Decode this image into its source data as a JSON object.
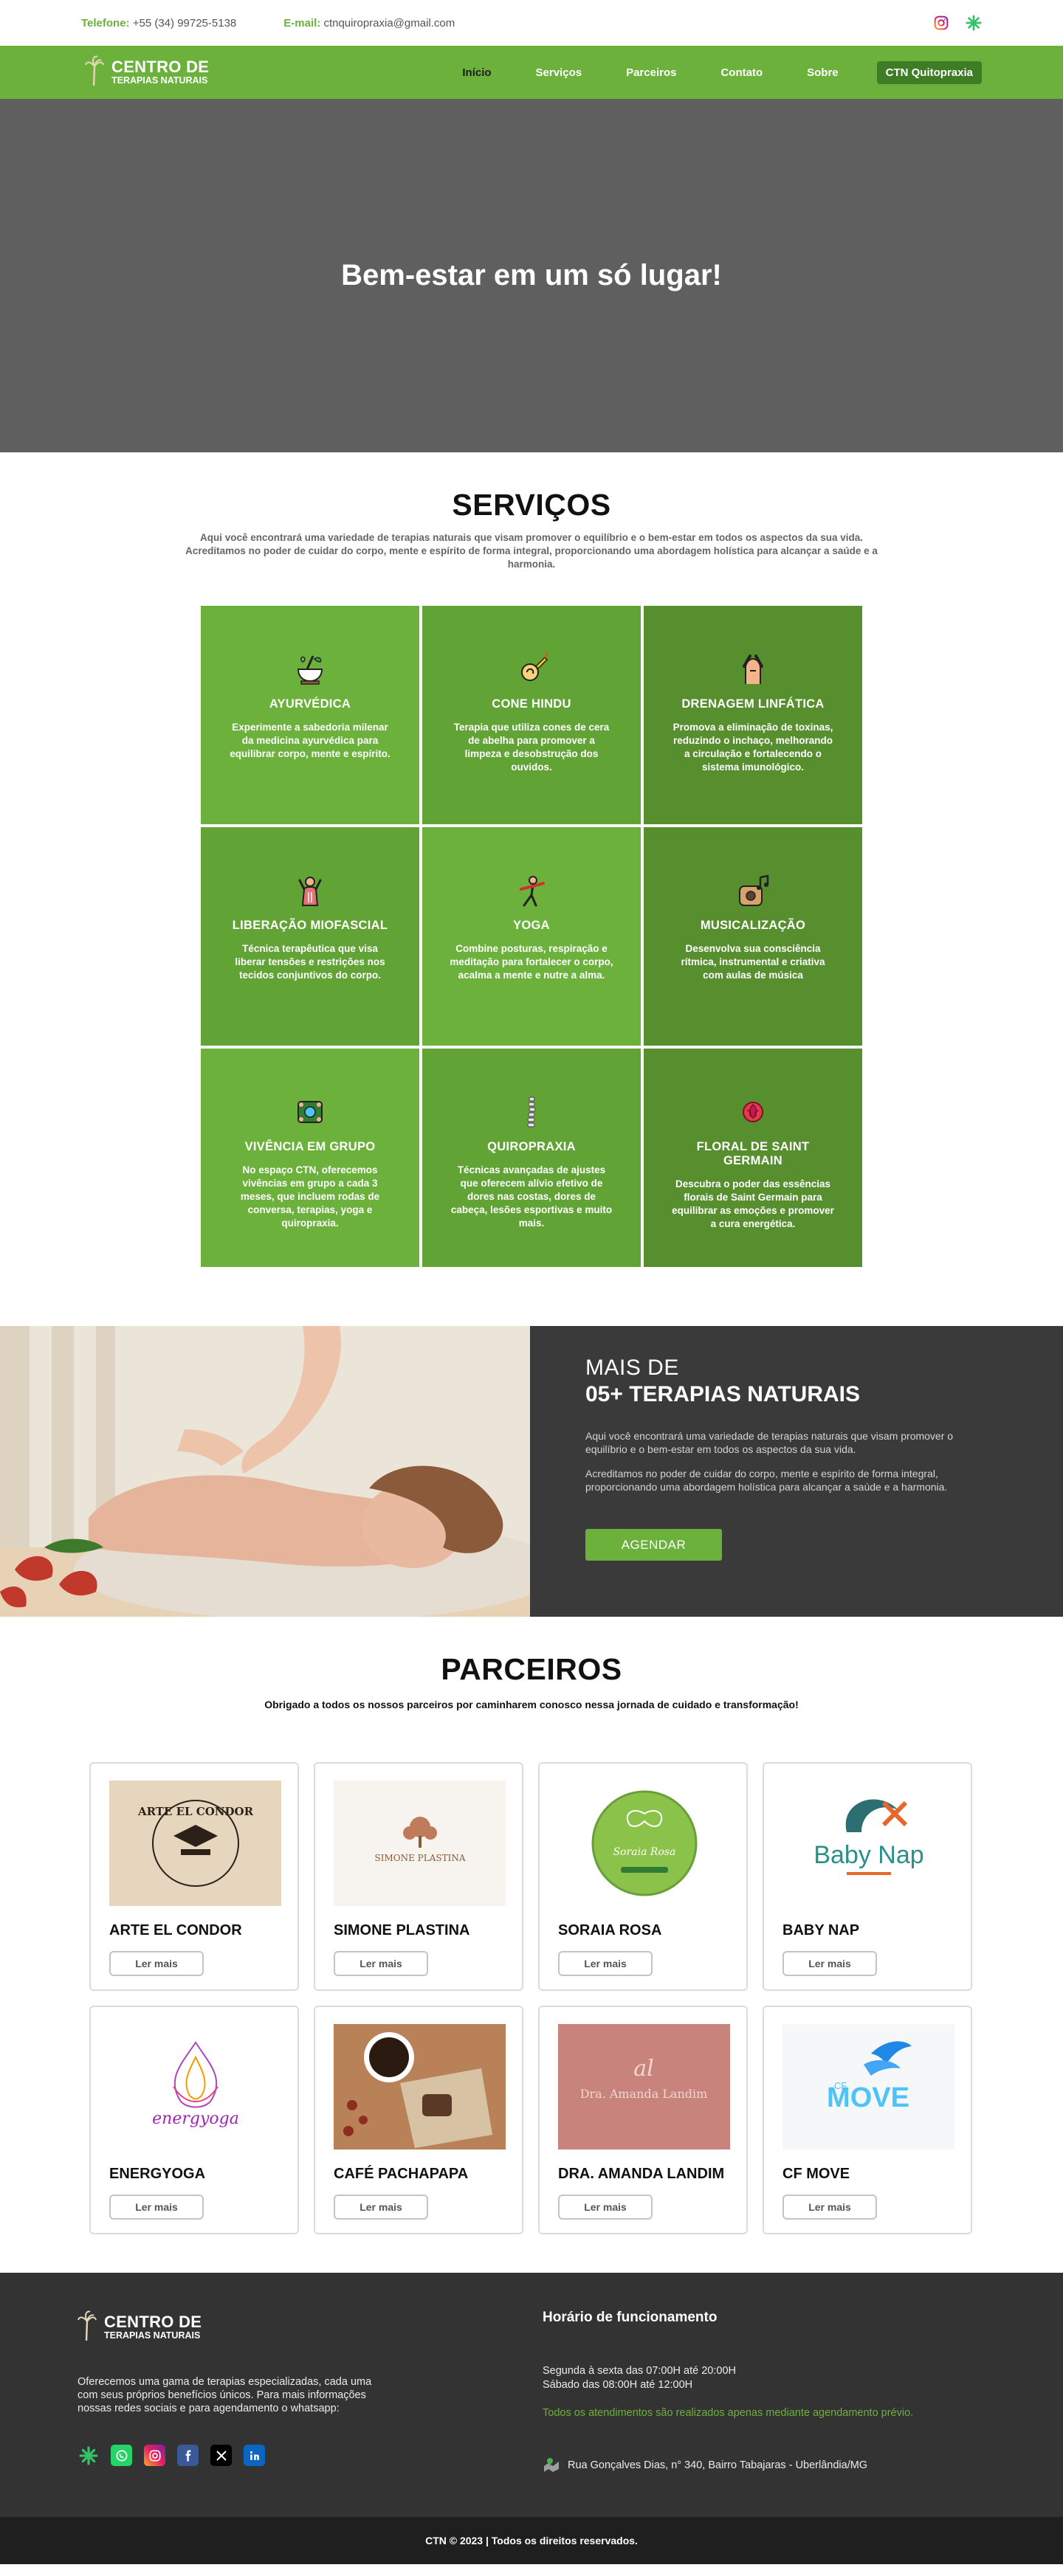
{
  "topbar": {
    "phone_label": "Telefone:",
    "phone": "+55 (34) 99725-5138",
    "email_label": "E-mail:",
    "email": "ctnquiropraxia@gmail.com",
    "socials": [
      "instagram-icon",
      "asterisk-flower-icon"
    ]
  },
  "brand": {
    "line1": "CENTRO DE",
    "line2": "TERAPIAS NATURAIS"
  },
  "nav": {
    "items": [
      "Início",
      "Serviços",
      "Parceiros",
      "Contato",
      "Sobre"
    ],
    "active": "Início",
    "cta": "CTN Quitopraxia"
  },
  "hero": {
    "title": "Bem-estar em um só lugar!"
  },
  "services": {
    "title": "SERVIÇOS",
    "intro": "Aqui você encontrará uma variedade de terapias naturais que visam promover o equilíbrio e o bem-estar em todos os aspectos da sua vida. Acreditamos no poder de cuidar do corpo, mente e espírito de forma integral, proporcionando uma abordagem holística para alcançar a saúde e a harmonia.",
    "items": [
      {
        "title": "AYURVÉDICA",
        "text": "Experimente a sabedoria milenar da medicina ayurvédica para equilibrar corpo, mente e espírito.",
        "icon": "mortar-herbs-icon"
      },
      {
        "title": "CONE HINDU",
        "text": "Terapia que utiliza cones de cera de abelha para promover a limpeza e desobstrução dos ouvidos.",
        "icon": "ear-cone-icon"
      },
      {
        "title": "DRENAGEM LINFÁTICA",
        "text": "Promova a eliminação de toxinas, reduzindo o inchaço, melhorando a circulação e fortalecendo o sistema imunológico.",
        "icon": "massage-hands-icon"
      },
      {
        "title": "LIBERAÇÃO MIOFASCIAL",
        "text": "Técnica terapêutica que visa liberar tensões e restrições nos tecidos conjuntivos do corpo.",
        "icon": "muscle-body-icon"
      },
      {
        "title": "YOGA",
        "text": "Combine posturas, respiração e meditação para fortalecer o corpo, acalma a mente e nutre a alma.",
        "icon": "yoga-pose-icon"
      },
      {
        "title": "MUSICALIZAÇÃO",
        "text": "Desenvolva sua consciência rítmica, instrumental e criativa com aulas de música",
        "icon": "music-notes-icon"
      },
      {
        "title": "VIVÊNCIA EM GRUPO",
        "text": "No espaço CTN, oferecemos vivências em grupo a cada 3 meses, que incluem rodas de conversa, terapias, yoga e quiropraxia.",
        "icon": "group-circle-icon"
      },
      {
        "title": "QUIROPRAXIA",
        "text": "Técnicas avançadas de ajustes que oferecem alívio efetivo de dores nas costas, dores de cabeça, lesões esportivas e muito mais.",
        "icon": "spine-icon"
      },
      {
        "title": "FLORAL DE SAINT GERMAIN",
        "text": "Descubra o poder das essências florais de Saint Germain para equilibrar as emoções e promover a cura energética.",
        "icon": "rose-flower-icon"
      }
    ]
  },
  "banner": {
    "pre": "MAIS DE",
    "headline": "05+ TERAPIAS NATURAIS",
    "p1": "Aqui você encontrará uma variedade de terapias naturais que visam promover o equilíbrio e o bem-estar em todos os aspectos da sua vida.",
    "p2": "Acreditamos no poder de cuidar do corpo, mente e espírito de forma integral, proporcionando uma abordagem holística para alcançar a saúde e a harmonia.",
    "button": "AGENDAR"
  },
  "partners": {
    "title": "PARCEIROS",
    "subtitle": "Obrigado a todos os nossos parceiros por caminharem conosco nessa jornada de cuidado e transformação!",
    "more_label": "Ler mais",
    "items": [
      {
        "name": "ARTE EL CONDOR",
        "logo_text": "ARTE EL CONDOR"
      },
      {
        "name": "SIMONE PLASTINA",
        "logo_text": "SIMONE PLASTINA"
      },
      {
        "name": "SORAIA ROSA",
        "logo_text": "Soraia Rosa"
      },
      {
        "name": "BABY NAP",
        "logo_text": "Baby Nap"
      },
      {
        "name": "ENERGYOGA",
        "logo_text": "energyoga"
      },
      {
        "name": "CAFÉ PACHAPAPA",
        "logo_text": ""
      },
      {
        "name": "DRA. AMANDA LANDIM",
        "logo_text": "Dra. Amanda Landim"
      },
      {
        "name": "CF MOVE",
        "logo_text": "MOVE"
      }
    ]
  },
  "footer": {
    "desc": "Oferecemos uma gama de terapias especializadas, cada uma com seus próprios benefícios únicos. Para mais informações nossas redes sociais e para agendamento o whatsapp:",
    "hours_title": "Horário de funcionamento",
    "hours1": "Segunda à sexta das 07:00H até 20:00H",
    "hours2": "Sábado das 08:00H até 12:00H",
    "note": "Todos os atendimentos são realizados apenas mediante agendamento prévio.",
    "address": "Rua Gonçalves Dias, n° 340, Bairro Tabajaras - Uberlândia/MG",
    "social_icons": [
      "asterisk-flower-icon",
      "whatsapp-icon",
      "instagram-icon",
      "facebook-icon",
      "x-icon",
      "linkedin-icon"
    ]
  },
  "copyright": "CTN © 2023 | Todos os direitos reservados.",
  "colors": {
    "green": "#6bb13c",
    "green_dark": "#578f2f",
    "dark": "#333333",
    "hero_gray": "#5f5f5f"
  }
}
